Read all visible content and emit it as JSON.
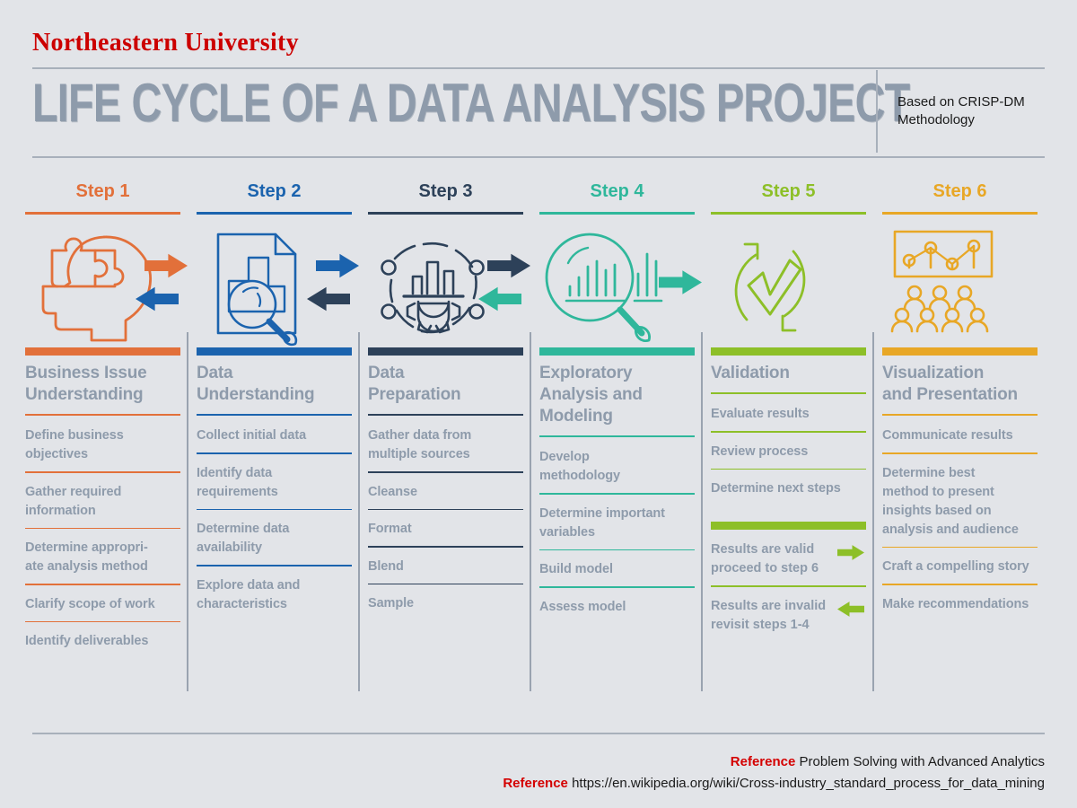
{
  "header": {
    "brand": "Northeastern University",
    "title": "LIFE CYCLE OF A DATA ANALYSIS PROJECT",
    "subtitle": "Based on CRISP-DM Methodology"
  },
  "palette": {
    "background": "#e2e4e8",
    "title_gray": "#8e9bab",
    "rule_gray": "#a8b0bb",
    "brand_red": "#cc0000",
    "reference_red": "#d40000",
    "step1": "#e2703a",
    "step2": "#1b63ae",
    "step3": "#2d4159",
    "step4": "#2fb79b",
    "step5": "#8dbf28",
    "step6": "#e8a726"
  },
  "columns": [
    {
      "step_label": "Step 1",
      "color": "#e2703a",
      "icon": "head-puzzle-icon",
      "arrow": "bidirectional-arrows-orange-blue",
      "title": "Business Issue\nUnderstanding",
      "bullets": [
        "Define business\nobjectives",
        "Gather required\ninformation",
        "Determine appropri-\nate analysis method",
        "Clarify scope of work",
        "Identify deliverables"
      ]
    },
    {
      "step_label": "Step 2",
      "color": "#1b63ae",
      "icon": "document-chart-magnifier-icon",
      "arrow": "bidirectional-arrows-blue-navy",
      "title": "Data\nUnderstanding",
      "bullets": [
        "Collect initial data",
        "Identify data\nrequirements",
        "Determine data\navailability",
        "Explore data and\ncharacteristics"
      ]
    },
    {
      "step_label": "Step 3",
      "color": "#2d4159",
      "icon": "gear-chart-network-icon",
      "arrow": "bidirectional-arrows-navy-teal",
      "title": "Data\nPreparation",
      "bullets": [
        "Gather data from\nmultiple sources",
        "Cleanse",
        "Format",
        "Blend",
        "Sample"
      ]
    },
    {
      "step_label": "Step 4",
      "color": "#2fb79b",
      "icon": "magnifier-barchart-icon",
      "arrow": "single-arrow-right-teal",
      "title": "Exploratory\nAnalysis and\nModeling",
      "bullets": [
        "Develop\nmethodology",
        "Determine important\nvariables",
        "Build model",
        "Assess model"
      ]
    },
    {
      "step_label": "Step 5",
      "color": "#8dbf28",
      "icon": "refresh-check-icon",
      "arrow": "none",
      "title": "Validation",
      "bullets": [
        "Evaluate results",
        "Review process",
        "Determine next steps"
      ],
      "callouts": [
        {
          "text": "Results are valid\nproceed to step 6",
          "arrow": "arrow-right-green"
        },
        {
          "text": "Results are invalid\nrevisit steps 1-4",
          "arrow": "arrow-left-green"
        }
      ]
    },
    {
      "step_label": "Step 6",
      "color": "#e8a726",
      "icon": "presentation-audience-icon",
      "arrow": "none",
      "title": "Visualization\nand Presentation",
      "bullets": [
        "Communicate results",
        "Determine best\nmethod to present\ninsights based on\nanalysis and audience",
        "Craft a compelling story",
        "Make recommendations"
      ]
    }
  ],
  "footer": {
    "references": [
      {
        "key": "Reference",
        "value": "Problem Solving with Advanced Analytics"
      },
      {
        "key": "Reference",
        "value": "https://en.wikipedia.org/wiki/Cross-industry_standard_process_for_data_mining"
      }
    ]
  }
}
